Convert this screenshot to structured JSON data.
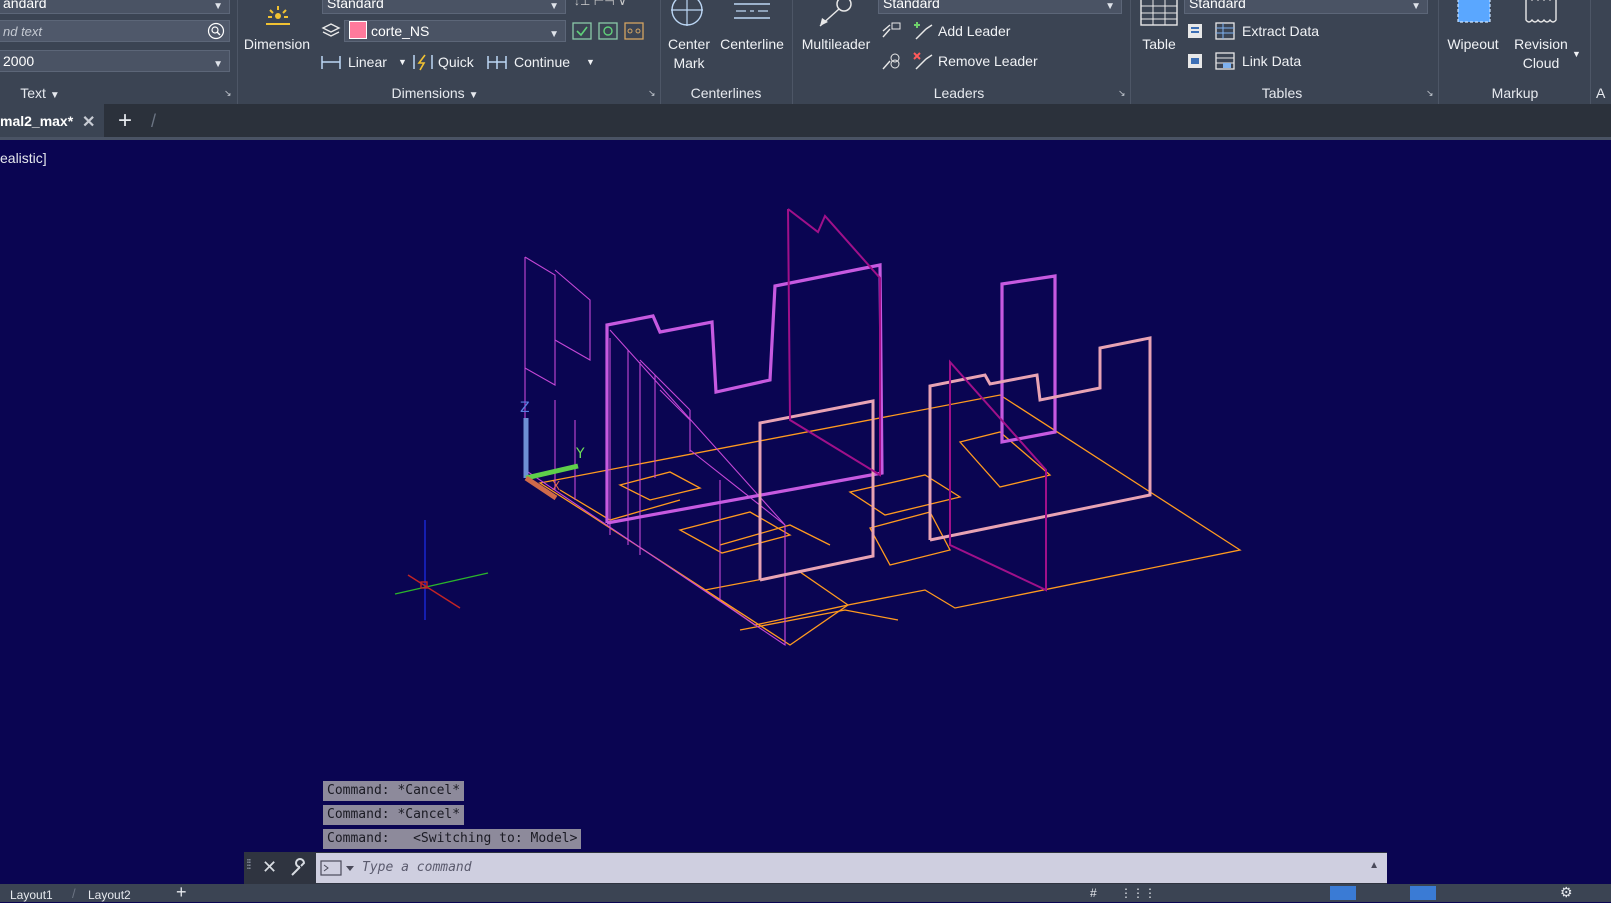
{
  "ribbon": {
    "text_panel": {
      "style_value": "Standard",
      "style_value_truncated": "andard",
      "find_placeholder": "nd text",
      "height_value": "2000",
      "title": "Text"
    },
    "dimension_button": "Dimension",
    "dimensions_panel": {
      "style_value": "Standard",
      "layer_value": "corte_NS",
      "linear_label": "Linear",
      "quick_label": "Quick",
      "continue_label": "Continue",
      "title": "Dimensions"
    },
    "centerlines_panel": {
      "center_mark_label": "Center\nMark",
      "centerline_label": "Centerline",
      "title": "Centerlines"
    },
    "leaders_panel": {
      "multileader_label": "Multileader",
      "style_value": "Standard",
      "add_leader_label": "Add Leader",
      "remove_leader_label": "Remove Leader",
      "title": "Leaders"
    },
    "tables_panel": {
      "table_label": "Table",
      "style_value": "Standard",
      "extract_data_label": "Extract Data",
      "link_data_label": "Link Data",
      "title": "Tables"
    },
    "markup_panel": {
      "wipeout_label": "Wipeout",
      "revision_cloud_label": "Revision\nCloud",
      "title": "Markup"
    },
    "next_panel_title": "A"
  },
  "tabs": {
    "active_file": "mal2_max*"
  },
  "viewport": {
    "view_label": "ealistic]"
  },
  "command_history": [
    "Command: *Cancel*",
    "Command: *Cancel*",
    "Command:   <Switching to: Model>"
  ],
  "command_input": {
    "placeholder": "Type a command"
  },
  "status_bar": {
    "layout1": "Layout1",
    "layout2": "Layout2"
  },
  "colors": {
    "viewport_bg": "#0a0552",
    "ribbon_bg": "#3b4453",
    "layer_swatch": "#ff7a9c",
    "magenta_lines": "#c447d6",
    "pink_lines": "#e8a3b4",
    "orange_lines": "#ff9a1f"
  }
}
